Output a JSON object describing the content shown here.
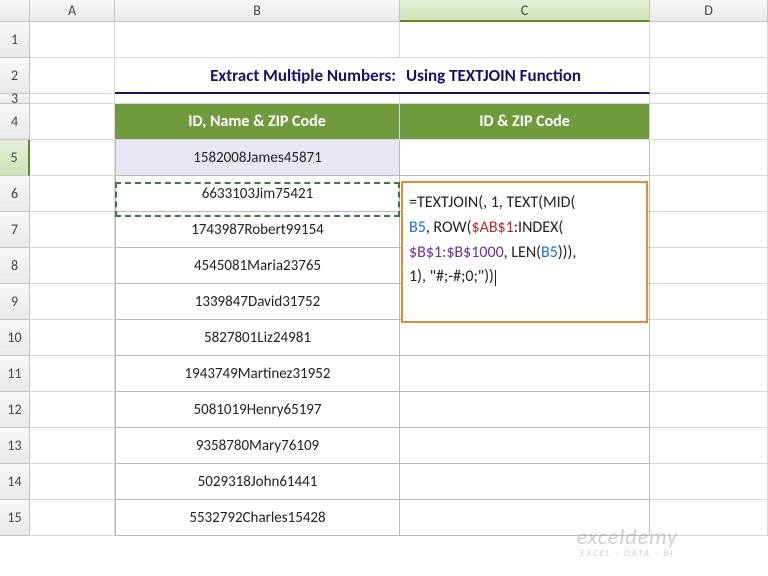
{
  "cols": {
    "A": "A",
    "B": "B",
    "C": "C",
    "D": "D"
  },
  "rows": [
    "1",
    "2",
    "3",
    "4",
    "5",
    "6",
    "7",
    "8",
    "9",
    "10",
    "11",
    "12",
    "13",
    "14",
    "15"
  ],
  "title": {
    "b": "Extract Multiple Numbers:",
    "c": "Using TEXTJOIN Function"
  },
  "headers": {
    "b": "ID, Name & ZIP Code",
    "c": "ID & ZIP Code"
  },
  "data": {
    "b5": "1582008James45871",
    "b6": "6633103Jim75421",
    "b7": "1743987Robert99154",
    "b8": "4545081Maria23765",
    "b9": "1339847David31752",
    "b10": "5827801Liz24981",
    "b11": "1943749Martinez31952",
    "b12": "5081019Henry65197",
    "b13": "9358780Mary76109",
    "b14": "5029318John61441",
    "b15": "5532792Charles15428"
  },
  "formula": {
    "p1": "=TEXTJOIN(, 1, TEXT(MID(",
    "p2a": "B5",
    "p2b": ", ROW(",
    "p2c": "$AB$1",
    "p2d": ":INDEX(",
    "p3a": "$B$1:$B$1000",
    "p3b": ", LEN(",
    "p3c": "B5",
    "p3d": "))),",
    "p4": "1), \"#;-#;0;\"))"
  },
  "watermark": {
    "line1": "exceldemy",
    "line2": "EXCEL · DATA · BI"
  }
}
